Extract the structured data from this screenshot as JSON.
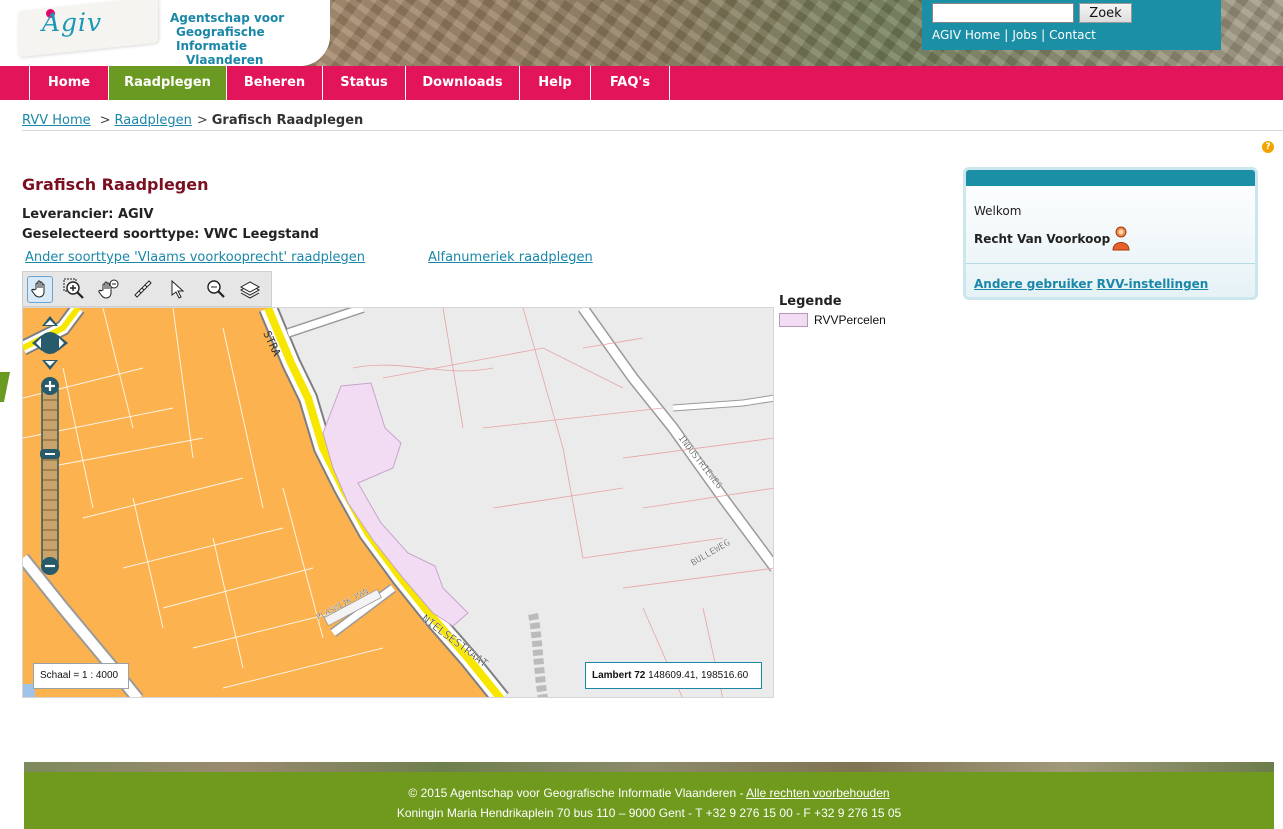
{
  "header": {
    "logo_text": "Agiv",
    "agency_lines": [
      "Agentschap voor",
      "Geografische Informatie",
      "Vlaanderen"
    ],
    "search": {
      "value": "",
      "button_label": "Zoek"
    },
    "top_links": [
      "AGIV Home",
      "Jobs",
      "Contact"
    ]
  },
  "nav": {
    "items": [
      {
        "label": "Home",
        "active": false
      },
      {
        "label": "Raadplegen",
        "active": true
      },
      {
        "label": "Beheren",
        "active": false
      },
      {
        "label": "Status",
        "active": false
      },
      {
        "label": "Downloads",
        "active": false
      },
      {
        "label": "Help",
        "active": false
      },
      {
        "label": "FAQ's",
        "active": false
      }
    ]
  },
  "breadcrumb": {
    "items": [
      "RVV Home",
      "Raadplegen"
    ],
    "separator": ">",
    "current": "Grafisch Raadplegen"
  },
  "main": {
    "title": "Grafisch Raadplegen",
    "supplier": "Leverancier: AGIV",
    "sorttype": "Geselecteerd soorttype: VWC Leegstand",
    "link_other": "Ander soorttype 'Vlaams voorkooprecht' raadplegen",
    "link_alpha": "Alfanumeriek raadplegen"
  },
  "toolbar": {
    "tools": [
      "pan-hand-icon",
      "zoom-in-box-icon",
      "zoom-out-hand-icon",
      "measure-ruler-icon",
      "select-pointer-icon",
      "zoom-search-icon",
      "layers-icon"
    ]
  },
  "map": {
    "street_labels": [
      "NIELSESTRAAT",
      "INDUSTRIEWEG",
      "BULLEWEG",
      "PLASWIJK PAN"
    ],
    "scale_text": "Schaal = 1 : 4000",
    "coord_label": "Lambert 72",
    "coord_value": "148609.41, 198516.60"
  },
  "legend": {
    "title": "Legende",
    "items": [
      {
        "label": "RVVPercelen",
        "color": "#f2dcf4"
      }
    ]
  },
  "user_panel": {
    "welcome": "Welkom",
    "user_name": "Recht Van Voorkoop",
    "links": [
      "Andere gebruiker",
      "RVV-instellingen"
    ]
  },
  "footer": {
    "copyright": "© 2015 Agentschap voor Geografische Informatie Vlaanderen - ",
    "rights_link": "Alle rechten voorbehouden",
    "address": "Koningin Maria Hendrikaplein 70 bus 110 – 9000 Gent - T +32 9 276 15 00 - F +32 9 276 15 05"
  },
  "colors": {
    "brand_pink": "#e3155a",
    "nav_active_green": "#6a9a22",
    "teal": "#1a8fa6",
    "title_maroon": "#7a0f20",
    "map_orange": "#fbb24f",
    "parcel_pink": "#f2dcf4"
  }
}
